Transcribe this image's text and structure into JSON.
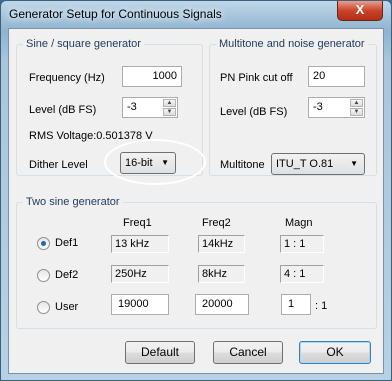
{
  "window": {
    "title": "Generator Setup for Continuous Signals",
    "close_glyph": "X"
  },
  "sine_square": {
    "legend": "Sine / square generator",
    "frequency_label": "Frequency (Hz)",
    "frequency_value": "1000",
    "level_label": "Level (dB FS)",
    "level_value": "-3",
    "rms_text": "RMS Voltage:0.501378 V",
    "dither_label": "Dither Level",
    "dither_value": "16-bit"
  },
  "multitone": {
    "legend": "Multitone and noise generator",
    "pink_label": "PN Pink cut off",
    "pink_value": "20",
    "level_label": "Level (dB FS)",
    "level_value": "-3",
    "multitone_label": "Multitone",
    "multitone_value": "ITU_T O.81"
  },
  "two_sine": {
    "legend": "Two sine generator",
    "headers": {
      "freq1": "Freq1",
      "freq2": "Freq2",
      "magn": "Magn"
    },
    "rows": [
      {
        "label": "Def1",
        "freq1": "13 kHz",
        "freq2": "14kHz",
        "magn": "1 : 1",
        "checked": true
      },
      {
        "label": "Def2",
        "freq1": "250Hz",
        "freq2": "8kHz",
        "magn": "4 : 1",
        "checked": false
      }
    ],
    "user": {
      "label": "User",
      "freq1": "19000",
      "freq2": "20000",
      "magn": "1",
      "magn_suffix": ": 1"
    }
  },
  "buttons": {
    "default": "Default",
    "cancel": "Cancel",
    "ok": "OK"
  },
  "colors": {
    "title_bar": "#8fb3cf",
    "close": "#c8452b",
    "group_title": "#1e395b",
    "radio_dot": "#2a64ad",
    "annotation": "#ffffff"
  },
  "icons": {
    "close": "close-icon",
    "spin_up": "spin-up-icon",
    "spin_down": "spin-down-icon",
    "dropdown": "chevron-down-icon"
  }
}
